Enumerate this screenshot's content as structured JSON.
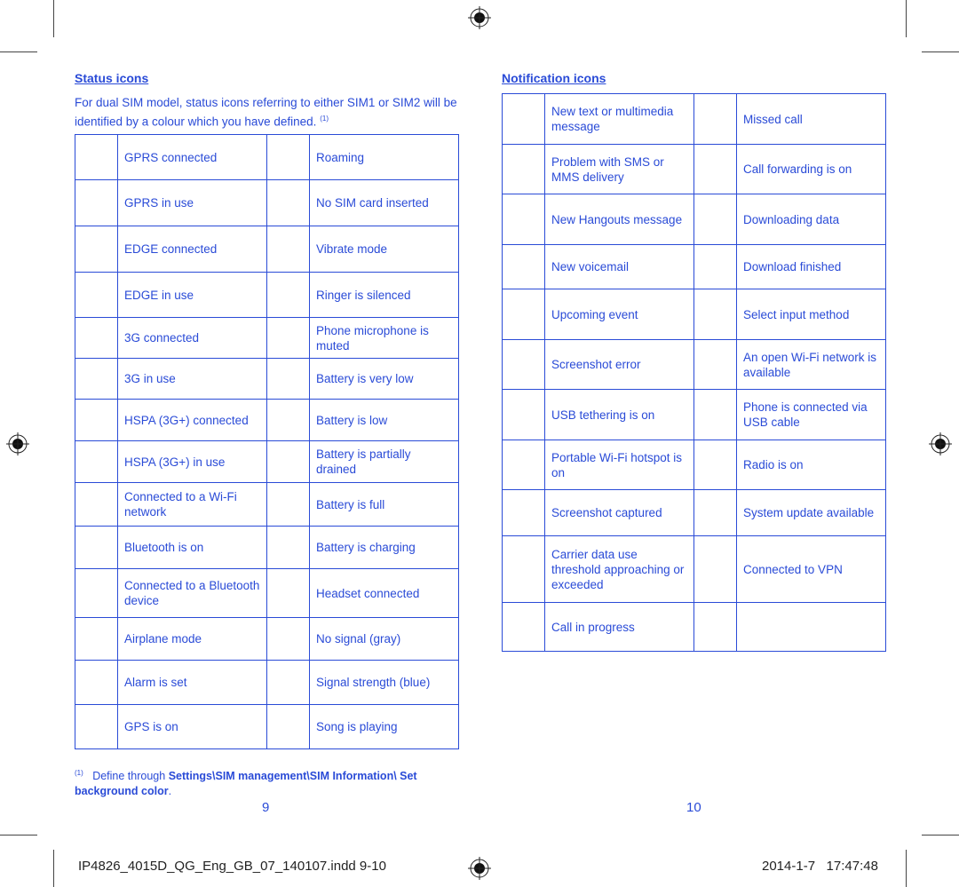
{
  "colors": {
    "text": "#2a4bd7"
  },
  "left": {
    "heading": "Status icons",
    "intro": "For dual SIM model, status icons referring to either SIM1 or SIM2 will be identified by a colour which you have defined.",
    "intro_note": "(1)",
    "rows": [
      [
        "GPRS connected",
        "Roaming"
      ],
      [
        "GPRS in use",
        "No SIM card inserted"
      ],
      [
        "EDGE connected",
        "Vibrate mode"
      ],
      [
        "EDGE in use",
        "Ringer is silenced"
      ],
      [
        "3G connected",
        "Phone microphone is muted"
      ],
      [
        "3G in use",
        "Battery is very low"
      ],
      [
        "HSPA (3G+) connected",
        "Battery is low"
      ],
      [
        "HSPA (3G+) in use",
        "Battery is partially drained"
      ],
      [
        "Connected to a Wi-Fi network",
        "Battery is full"
      ],
      [
        "Bluetooth is on",
        "Battery is charging"
      ],
      [
        "Connected to a Bluetooth device",
        "Headset connected"
      ],
      [
        "Airplane mode",
        "No signal (gray)"
      ],
      [
        "Alarm is set",
        "Signal strength (blue)"
      ],
      [
        "GPS is on",
        "Song is playing"
      ]
    ],
    "footnote_mark": "(1)",
    "footnote_text": "Define through",
    "footnote_path": "Settings\\SIM management\\SIM Information\\ Set background color",
    "footnote_end": ".",
    "page_number": "9"
  },
  "right": {
    "heading": "Notification icons",
    "rows": [
      [
        "New text or multimedia message",
        "Missed call"
      ],
      [
        "Problem with SMS or MMS delivery",
        "Call forwarding is on"
      ],
      [
        "New Hangouts message",
        "Downloading data"
      ],
      [
        "New voicemail",
        "Download finished"
      ],
      [
        "Upcoming event",
        "Select input method"
      ],
      [
        "Screenshot error",
        "An open Wi-Fi network is available"
      ],
      [
        "USB tethering is on",
        "Phone is connected via USB cable"
      ],
      [
        "Portable Wi-Fi hotspot is on",
        "Radio is on"
      ],
      [
        "Screenshot captured",
        "System update available"
      ],
      [
        "Carrier data use threshold approaching or exceeded",
        "Connected to VPN"
      ],
      [
        "Call in progress",
        ""
      ]
    ],
    "page_number": "10"
  },
  "slug": {
    "filename": "IP4826_4015D_QG_Eng_GB_07_140107.indd   9-10",
    "timestamp": "2014-1-7   17:47:48"
  }
}
